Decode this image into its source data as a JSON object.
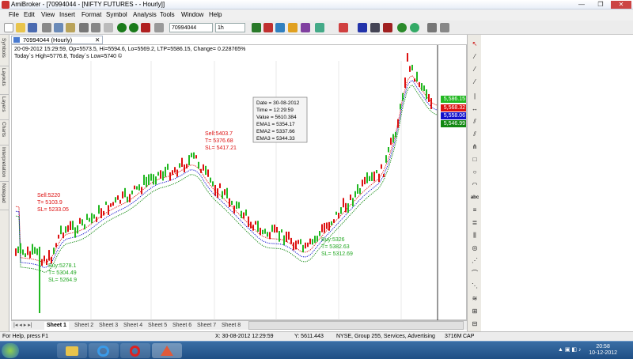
{
  "window": {
    "title": "AmiBroker - [70994044 - [NIFTY FUTURES - - Hourly]]",
    "controls": [
      "—",
      "❐",
      "✕"
    ]
  },
  "menu": [
    "File",
    "Edit",
    "View",
    "Insert",
    "Format",
    "Symbol",
    "Analysis",
    "Tools",
    "Window",
    "Help"
  ],
  "toolbar": {
    "symbol": "70994044",
    "interval": "1h"
  },
  "left_tabs": [
    "Symbols",
    "Layouts",
    "Layers",
    "Charts",
    "Interpretation",
    "Notepad"
  ],
  "doc_tab": {
    "label": "70994044 (Hourly)"
  },
  "chart": {
    "info_line1": "20-09-2012 15:29:59, Op=5573.5, Hi=5594.6, Lo=5569.2, LTP=5586.15, Change= 0.228765%",
    "info_line2": "Today`s High=5776.8, Today`s Low=5740 ©",
    "tooltip": [
      "Date = 30-08-2012",
      "Time = 12:29:59",
      "Value = 5610.384",
      "EMA1 = 5354.17",
      "EMA2 = 5337.66",
      "EMA3 = 5344.33"
    ],
    "annotations": {
      "sell1": [
        "Sell:5220",
        "T= 5103.9",
        "SL= 5233.05"
      ],
      "sell2": [
        "Sell:5403.7",
        "T= 5376.68",
        "SL= 5417.21"
      ],
      "buy1": [
        "Buy:5278.1",
        "T= 5304.49",
        "SL= 5264.9"
      ],
      "buy2": [
        "Buy:5326",
        "T= 5382.63",
        "SL= 5312.69"
      ]
    },
    "price_labels": [
      {
        "text": "5,586.15",
        "color": "#22b822"
      },
      {
        "text": "5,568.32",
        "color": "#dd1111"
      },
      {
        "text": "5,558.06",
        "color": "#1111cc"
      },
      {
        "text": "5,546.99",
        "color": "#118811"
      }
    ]
  },
  "sheets": [
    "Sheet 1",
    "Sheet 2",
    "Sheet 3",
    "Sheet 4",
    "Sheet 5",
    "Sheet 6",
    "Sheet 7",
    "Sheet 8"
  ],
  "status": {
    "help": "For Help, press F1",
    "cursor": "X: 30-08-2012 12:29:59",
    "y": "Y: 5611.443",
    "info": "NYSE, Group 255, Services, Advertising",
    "mem": "3716M",
    "cap": "CAP"
  },
  "clock": {
    "time": "20:58",
    "date": "10-12-2012"
  },
  "colors": {
    "up": "#22b822",
    "down": "#dd1111",
    "ema1": "#dd1111",
    "ema2": "#1111cc",
    "ema3": "#118811"
  }
}
